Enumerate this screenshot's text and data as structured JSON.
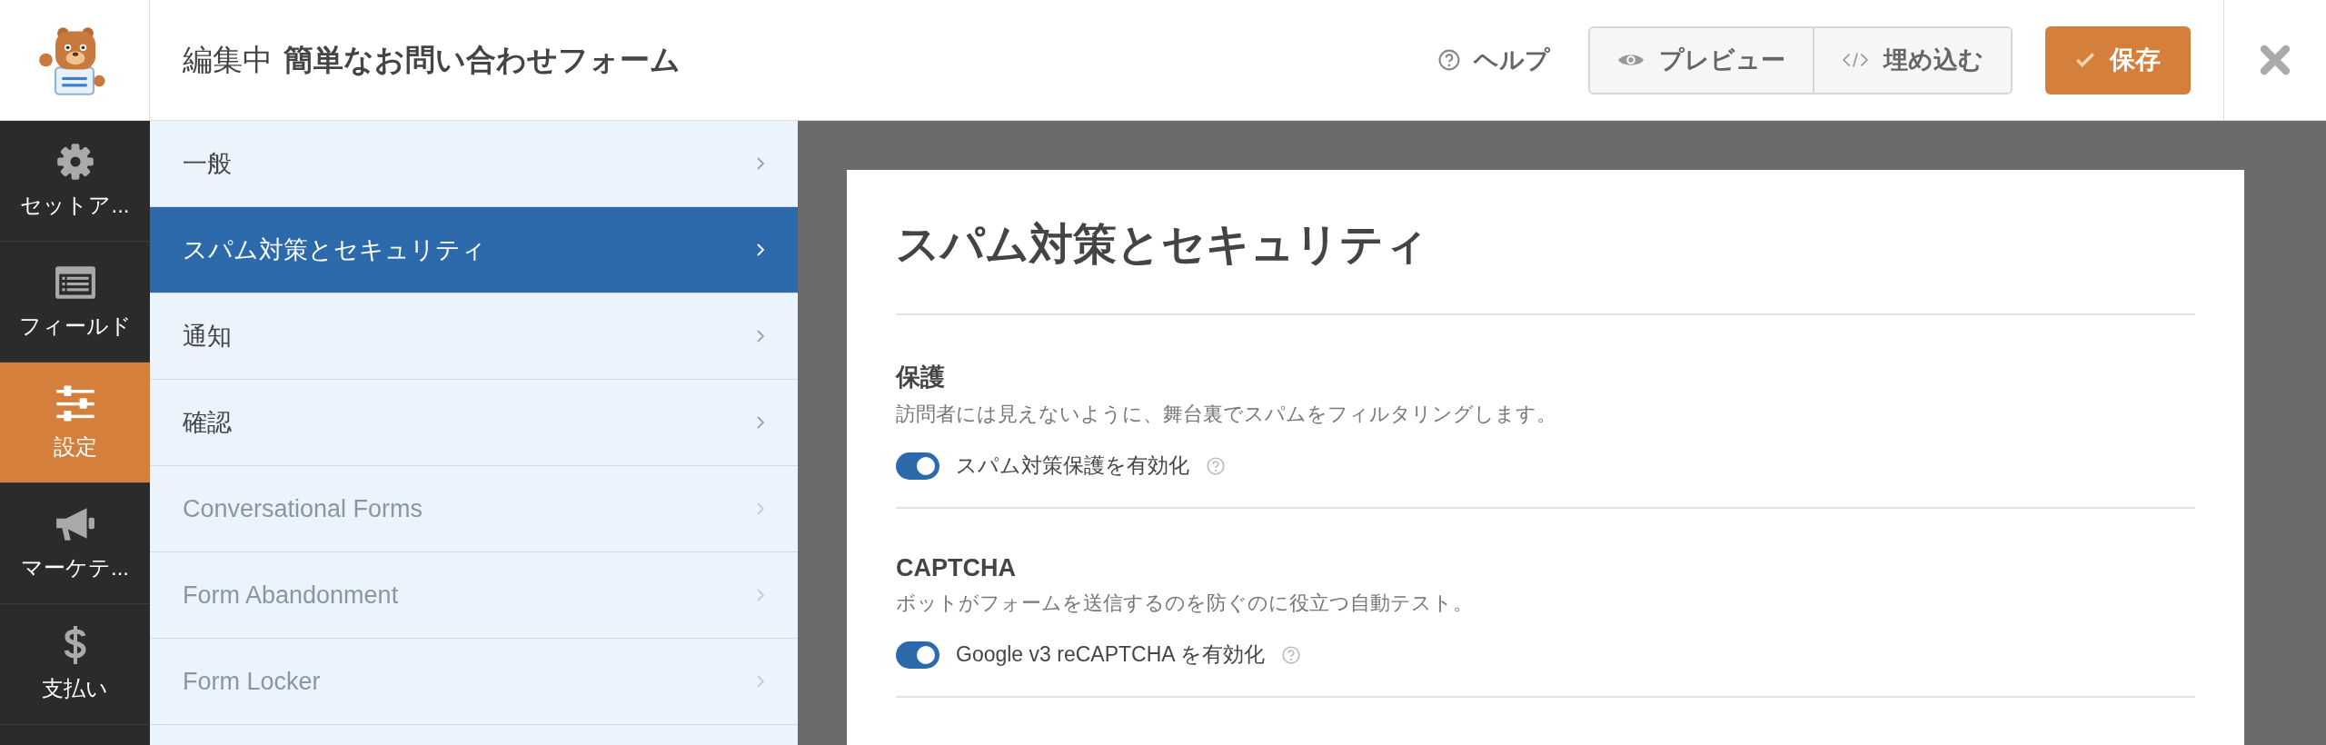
{
  "header": {
    "editing_label": "編集中",
    "form_title": "簡単なお問い合わせフォーム",
    "help": "ヘルプ",
    "preview": "プレビュー",
    "embed": "埋め込む",
    "save": "保存"
  },
  "rail": [
    {
      "kind": "gear",
      "label": "セットア...",
      "selected": false
    },
    {
      "kind": "fields",
      "label": "フィールド",
      "selected": false
    },
    {
      "kind": "sliders",
      "label": "設定",
      "selected": true
    },
    {
      "kind": "megaphone",
      "label": "マーケテ...",
      "selected": false
    },
    {
      "kind": "dollar",
      "label": "支払い",
      "selected": false
    }
  ],
  "menu": [
    {
      "label": "一般",
      "selected": false,
      "disabled": false
    },
    {
      "label": "スパム対策とセキュリティ",
      "selected": true,
      "disabled": false
    },
    {
      "label": "通知",
      "selected": false,
      "disabled": false
    },
    {
      "label": "確認",
      "selected": false,
      "disabled": false
    },
    {
      "label": "Conversational Forms",
      "selected": false,
      "disabled": true
    },
    {
      "label": "Form Abandonment",
      "selected": false,
      "disabled": true
    },
    {
      "label": "Form Locker",
      "selected": false,
      "disabled": true
    }
  ],
  "panel": {
    "title": "スパム対策とセキュリティ",
    "sections": [
      {
        "heading": "保護",
        "description": "訪問者には見えないように、舞台裏でスパムをフィルタリングします。",
        "toggle": {
          "label": "スパム対策保護を有効化",
          "on": true
        }
      },
      {
        "heading": "CAPTCHA",
        "description": "ボットがフォームを送信するのを防ぐのに役立つ自動テスト。",
        "toggle": {
          "label": "Google v3 reCAPTCHA を有効化",
          "on": true
        }
      }
    ]
  }
}
